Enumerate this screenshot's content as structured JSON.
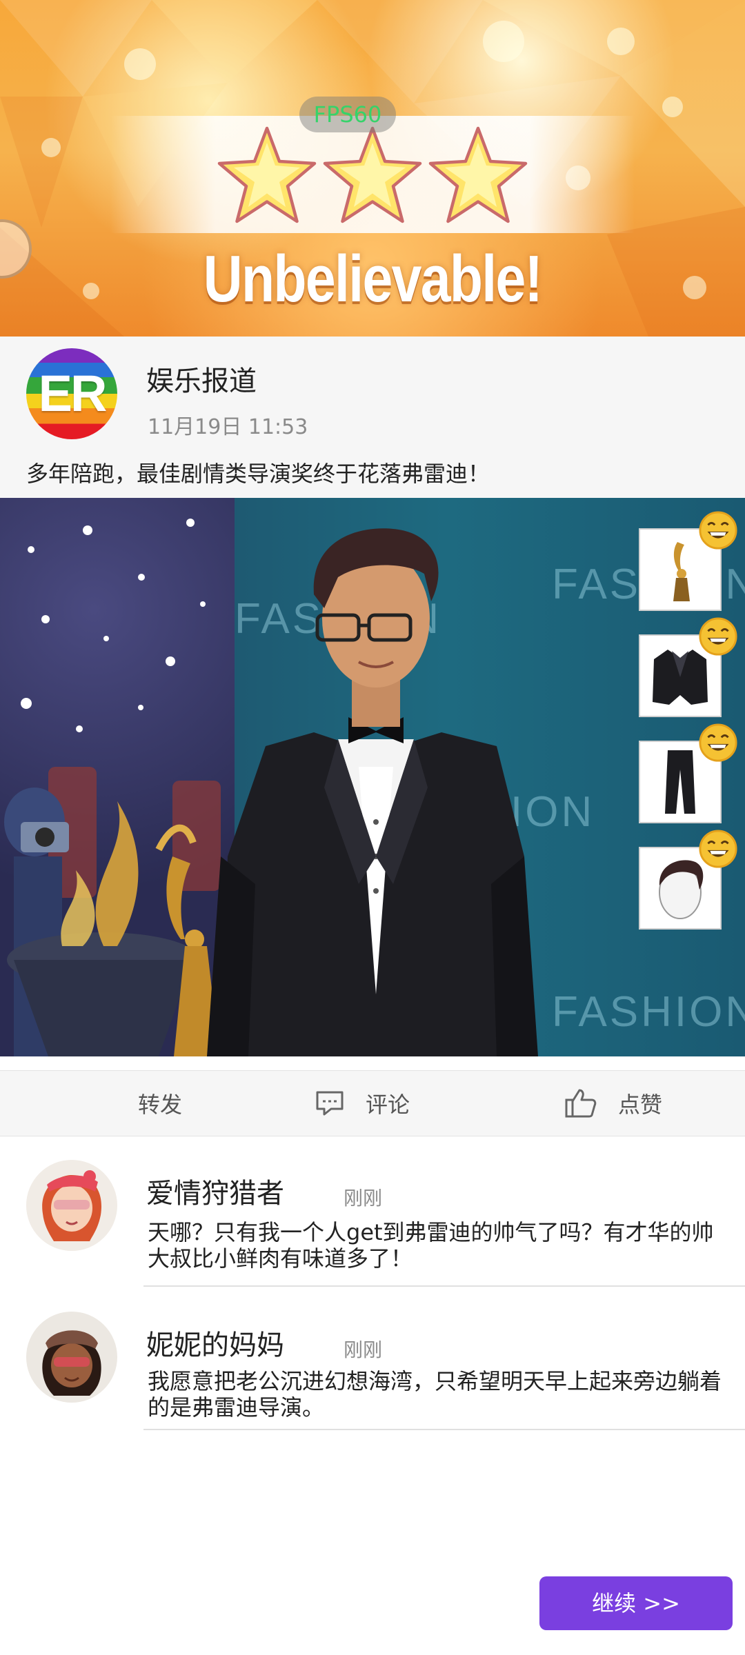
{
  "banner": {
    "fps_label": "FPS60",
    "stars_earned": 3,
    "stars_total": 3,
    "title": "Unbelievable!"
  },
  "post": {
    "avatar_text": "ER",
    "author": "娱乐报道",
    "time": "11月19日 11:53",
    "text": "多年陪跑，最佳剧情类导演奖终于花落弗雷迪！"
  },
  "scene": {
    "background_text": [
      "FASHION",
      "FASHION",
      "ION",
      "FASHION"
    ],
    "outfit_items": [
      "trophy-icon",
      "tuxedo-jacket-icon",
      "trousers-icon",
      "hairstyle-icon"
    ],
    "item_badge_icon": "smiley-icon"
  },
  "actions": {
    "share_label": "转发",
    "comment_label": "评论",
    "like_label": "点赞"
  },
  "comments": [
    {
      "name": "爱情狩猎者",
      "time": "刚刚",
      "text": "天哪？只有我一个人get到弗雷迪的帅气了吗？有才华的帅大叔比小鲜肉有味道多了！"
    },
    {
      "name": "妮妮的妈妈",
      "time": "刚刚",
      "text": "我愿意把老公沉进幻想海湾，只希望明天早上起来旁边躺着的是弗雷迪导演。"
    }
  ],
  "continue_label": "继续 >>",
  "colors": {
    "accent": "#7a3fe0",
    "banner_orange": "#f6b24d",
    "fps_green": "#36d36a"
  }
}
